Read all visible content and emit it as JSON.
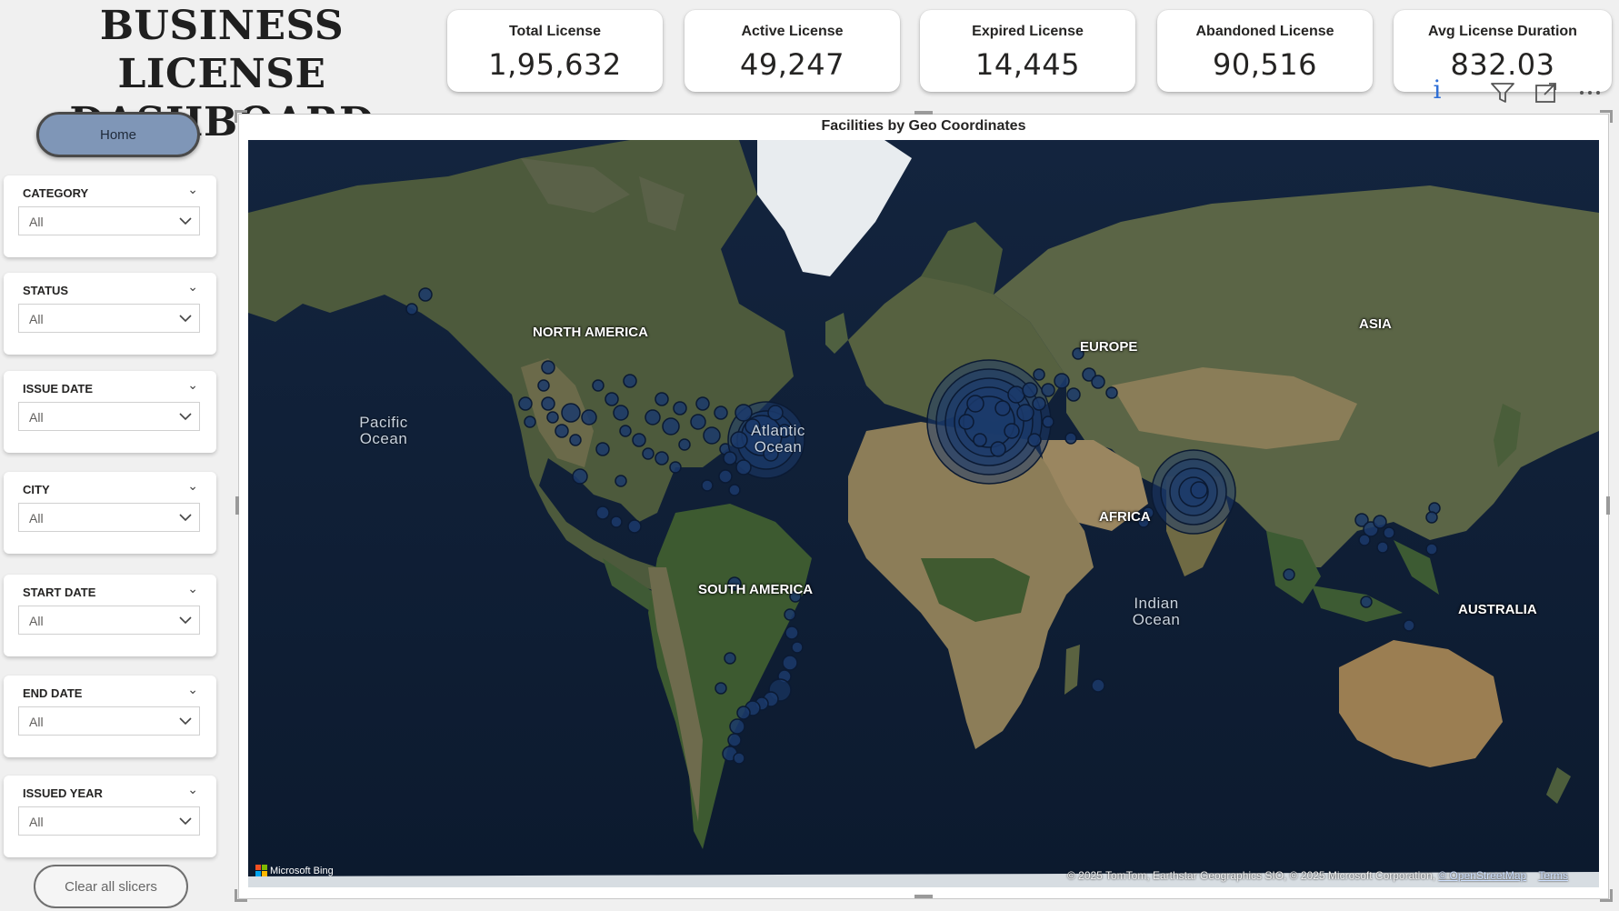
{
  "header": {
    "title_line1": "BUSINESS LICENSE",
    "title_line2": "DASHBOARD"
  },
  "kpis": [
    {
      "label": "Total License",
      "value": "1,95,632"
    },
    {
      "label": "Active License",
      "value": "49,247"
    },
    {
      "label": "Expired License",
      "value": "14,445"
    },
    {
      "label": "Abandoned License",
      "value": "90,516"
    },
    {
      "label": "Avg License Duration",
      "value": "832.03"
    }
  ],
  "nav": {
    "home_label": "Home",
    "clear_label": "Clear all slicers"
  },
  "slicers": [
    {
      "title": "CATEGORY",
      "value": "All"
    },
    {
      "title": "STATUS",
      "value": "All"
    },
    {
      "title": "ISSUE DATE",
      "value": "All"
    },
    {
      "title": "CITY",
      "value": "All"
    },
    {
      "title": "START DATE",
      "value": "All"
    },
    {
      "title": "END DATE",
      "value": "All"
    },
    {
      "title": "ISSUED YEAR",
      "value": "All"
    }
  ],
  "visual_toolbar": {
    "icons": [
      "info-icon",
      "filter-icon",
      "focus-mode-icon",
      "more-options-icon"
    ]
  },
  "map": {
    "title": "Facilities by Geo Coordinates",
    "labels": {
      "north_america": "NORTH AMERICA",
      "europe": "EUROPE",
      "asia": "ASIA",
      "africa": "AFRICA",
      "south_america": "SOUTH AMERICA",
      "australia": "AUSTRALIA"
    },
    "oceans": {
      "pacific_l1": "Pacific",
      "pacific_l2": "Ocean",
      "atlantic_l1": "Atlantic",
      "atlantic_l2": "Ocean",
      "indian_l1": "Indian",
      "indian_l2": "Ocean"
    },
    "provider": "Microsoft Bing",
    "copyright": "© 2025 TomTom, Earthstar Geographics SIO, © 2025 Microsoft Corporation,",
    "osm_link": "© OpenStreetMap",
    "terms_link": "Terms",
    "bubble_color": "#1b3a6b",
    "bubble_stroke": "#0b1a33"
  }
}
